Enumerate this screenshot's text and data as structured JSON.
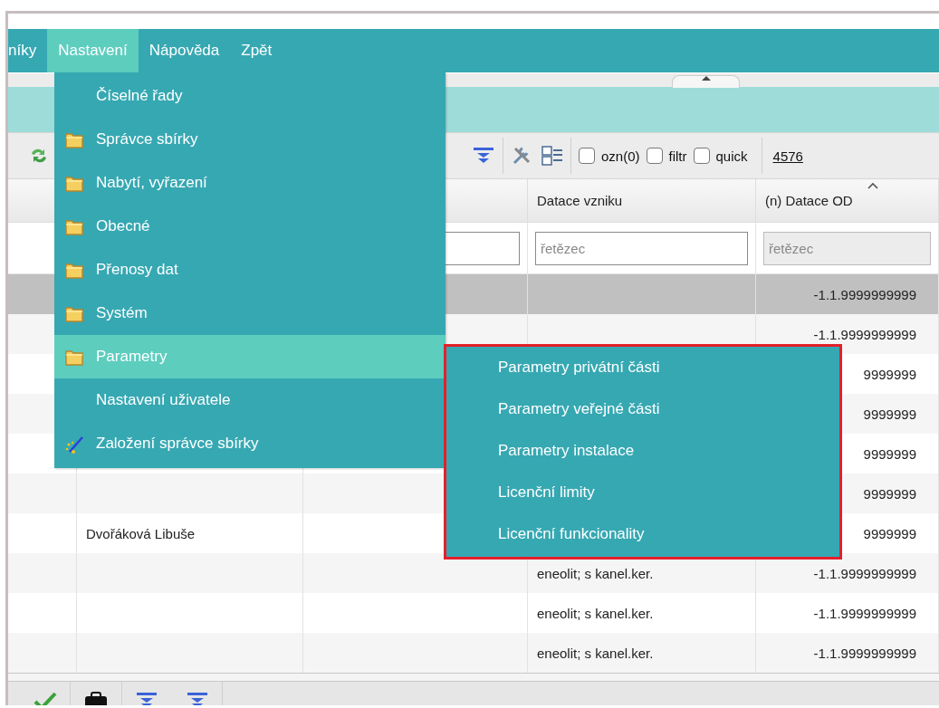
{
  "menubar": [
    {
      "label": "níky",
      "selected": false
    },
    {
      "label": "Nastavení",
      "selected": true
    },
    {
      "label": "Nápověda",
      "selected": false
    },
    {
      "label": "Zpět",
      "selected": false
    }
  ],
  "menu": {
    "items": [
      {
        "label": "Číselné řady",
        "kind": "plain",
        "selected": false
      },
      {
        "label": "Správce sbírky",
        "kind": "folder",
        "selected": false
      },
      {
        "label": "Nabytí, vyřazení",
        "kind": "folder",
        "selected": false
      },
      {
        "label": "Obecné",
        "kind": "folder",
        "selected": false
      },
      {
        "label": "Přenosy dat",
        "kind": "folder",
        "selected": false
      },
      {
        "label": "Systém",
        "kind": "folder",
        "selected": false
      },
      {
        "label": "Parametry",
        "kind": "folder",
        "selected": true
      },
      {
        "label": "Nastavení uživatele",
        "kind": "plain",
        "selected": false
      },
      {
        "label": "Založení správce sbírky",
        "kind": "wand",
        "selected": false
      }
    ]
  },
  "submenu": {
    "highlight_frame": true,
    "items": [
      {
        "label": "Parametry privátní části",
        "selected": false
      },
      {
        "label": "Parametry veřejné části",
        "selected": false
      },
      {
        "label": "Parametry instalace",
        "selected": false
      },
      {
        "label": "Licenční limity",
        "selected": false
      },
      {
        "label": "Licenční funkcionality",
        "selected": false
      }
    ]
  },
  "toolbar": {
    "checkboxes": [
      {
        "label": "ozn(0)",
        "checked": false
      },
      {
        "label": "filtr",
        "checked": false
      },
      {
        "label": "quick",
        "checked": false
      }
    ],
    "count_link": "4576"
  },
  "table": {
    "columns": [
      {
        "label": "Datace vzniku",
        "sorted": false
      },
      {
        "label": "(n) Datace OD",
        "sorted": true
      }
    ],
    "filters": [
      {
        "placeholder": "řetězec",
        "disabled": false
      },
      {
        "placeholder": "řetězec",
        "disabled": true
      }
    ],
    "rows": [
      {
        "selected": true,
        "datace_od": "-1.1.9999999999"
      },
      {
        "selected": false,
        "datace_od": "-1.1.9999999999"
      },
      {
        "selected": false,
        "datace_od": "9999999"
      },
      {
        "selected": false,
        "datace_od": "9999999"
      },
      {
        "selected": false,
        "datace_od": "9999999"
      },
      {
        "selected": false,
        "datace_od": "9999999"
      },
      {
        "selected": false,
        "column_2": "Dvořáková Libuše",
        "datace_od": "9999999"
      },
      {
        "selected": false,
        "datace_vzniku": "eneolit; s kanel.ker.",
        "datace_od": "-1.1.9999999999"
      },
      {
        "selected": false,
        "datace_vzniku": "eneolit; s kanel.ker.",
        "datace_od": "-1.1.9999999999"
      },
      {
        "selected": false,
        "datace_vzniku": "eneolit; s kanel.ker.",
        "datace_od": "-1.1.9999999999"
      }
    ]
  }
}
